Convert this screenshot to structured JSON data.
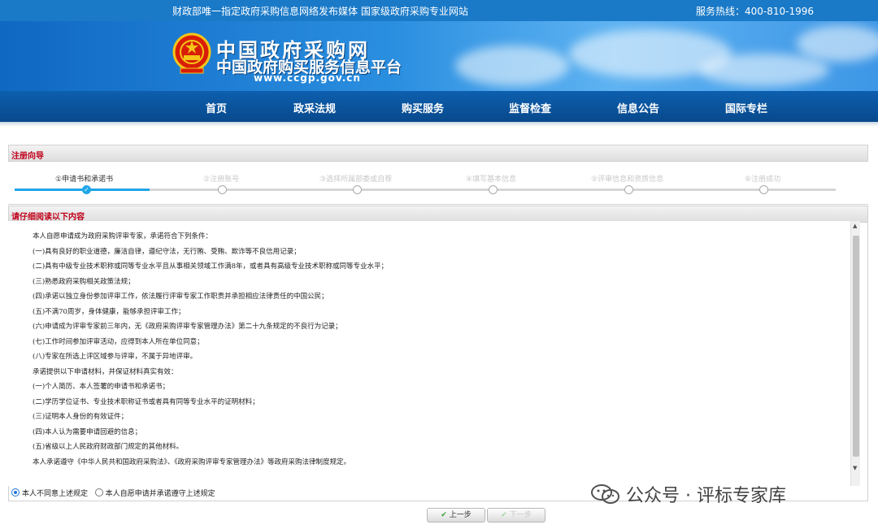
{
  "topbar": {
    "slogan": "财政部唯一指定政府采购信息网络发布媒体 国家级政府采购专业网站",
    "hotline": "服务热线：400-810-1996"
  },
  "logo": {
    "title_cn": "中国政府采购网",
    "subtitle_cn": "中国政府购买服务信息平台",
    "url": "www.ccgp.gov.cn"
  },
  "nav": {
    "items": [
      "首页",
      "政采法规",
      "购买服务",
      "监督检查",
      "信息公告",
      "国际专栏"
    ]
  },
  "wizard": {
    "title": "注册向导",
    "steps": [
      "①申请书和承诺书",
      "②注册账号",
      "③选择所属部委或自荐",
      "④填写基本信息",
      "⑤评审信息和资质信息",
      "⑥注册成功"
    ],
    "current_step": 1
  },
  "notice": {
    "title": "请仔细阅读以下内容",
    "lines": [
      "本人自愿申请成为政府采购评审专家，承诺符合下列条件：",
      "(一)具有良好的职业道德，廉洁自律，遵纪守法，无行贿、受贿、欺诈等不良信用记录；",
      "(二)具有中级专业技术职称或同等专业水平且从事相关领域工作满8年，或者具有高级专业技术职称或同等专业水平；",
      "(三)熟悉政府采购相关政策法规；",
      "(四)承诺以独立身份参加评审工作，依法履行评审专家工作职责并承担相应法律责任的中国公民；",
      "(五)不满70周岁，身体健康，能够承担评审工作；",
      "(六)申请成为评审专家前三年内，无《政府采购评审专家管理办法》第二十九条规定的不良行为记录；",
      "(七)工作时间参加评审活动，应得到本人所在单位同意；",
      "(八)专家在所选上评区域参与评审，不属于异地评审。",
      "承诺提供以下申请材料，并保证材料真实有效：",
      "(一)个人简历、本人签署的申请书和承诺书；",
      "(二)学历学位证书、专业技术职称证书或者具有同等专业水平的证明材料；",
      "(三)证明本人身份的有效证件；",
      "(四)本人认为需要申请回避的信息；",
      "(五)省级以上人民政府财政部门规定的其他材料。",
      "本人承诺遵守《中华人民共和国政府采购法》、《政府采购评审专家管理办法》等政府采购法律制度规定。"
    ]
  },
  "agreement": {
    "disagree_label": "本人不同意上述规定",
    "agree_label": "本人自愿申请并承诺遵守上述规定",
    "selected": "disagree"
  },
  "buttons": {
    "prev_label": "上一步",
    "next_label": "下一步"
  },
  "watermark": {
    "text": "公众号 · 评标专家库"
  },
  "colors": {
    "nav_bg": "#0b549e",
    "accent_red": "#c0001a",
    "progress_blue": "#1ea6e8"
  }
}
